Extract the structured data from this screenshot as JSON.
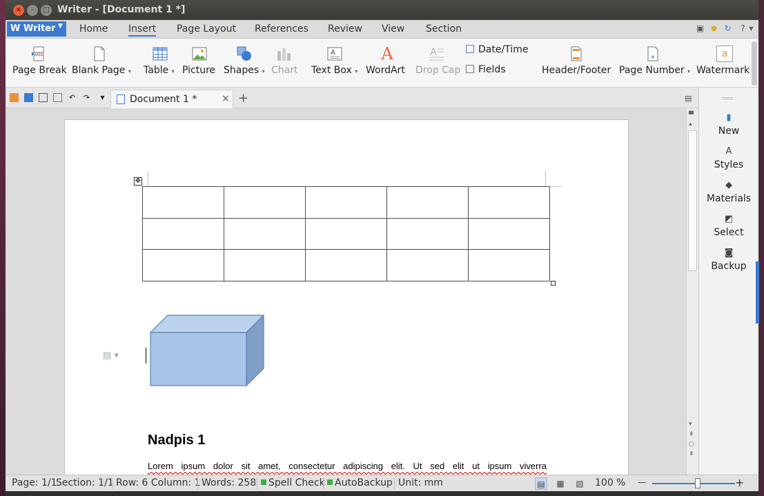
{
  "window": {
    "title": "Writer - [Document 1 *]",
    "controls": {
      "close": "×",
      "minimize": "–",
      "maximize": "□"
    }
  },
  "menu": {
    "app_button": "Writer",
    "tabs": [
      "Home",
      "Insert",
      "Page Layout",
      "References",
      "Review",
      "View",
      "Section"
    ],
    "active_tab": "Insert",
    "help": "?"
  },
  "ribbon": {
    "page_break": "Page Break",
    "blank_page": "Blank Page",
    "table": "Table",
    "picture": "Picture",
    "shapes": "Shapes",
    "chart": "Chart",
    "text_box": "Text Box",
    "wordart": "WordArt",
    "drop_cap": "Drop Cap",
    "date_time": "Date/Time",
    "fields": "Fields",
    "header_footer": "Header/Footer",
    "page_number": "Page Number",
    "watermark": "Watermark",
    "wordart_glyph": "A",
    "watermark_glyph": "a"
  },
  "doc_tabs": {
    "tabs": [
      {
        "label": "Document 1 *"
      }
    ],
    "close_glyph": "×",
    "add_glyph": "+"
  },
  "document": {
    "table": {
      "rows": 3,
      "cols": 5
    },
    "heading": "Nadpis 1",
    "body_line": "Lorem ipsum dolor sit amet, consectetur adipiscing elit. Ut sed elit ut ipsum viverra"
  },
  "task_pane": {
    "items": [
      "New",
      "Styles",
      "Materials",
      "Select",
      "Backup"
    ]
  },
  "status": {
    "page": "Page: 1/1",
    "section": "Section: 1/1",
    "row_col": "Row: 6 Column: 1",
    "words": "Words: 258",
    "spell_check": "Spell Check",
    "auto_backup": "AutoBackup",
    "unit": "Unit: mm",
    "zoom": "100 %",
    "zoom_fraction": 0.55,
    "minus": "—",
    "plus": "+"
  },
  "colors": {
    "accent": "#3c7bd1",
    "cube_front": "#a9c6e8",
    "cube_top": "#bcd3ee",
    "cube_side": "#7f9fc6",
    "cube_stroke": "#5b7fb0",
    "status_green": "#3cb043"
  }
}
